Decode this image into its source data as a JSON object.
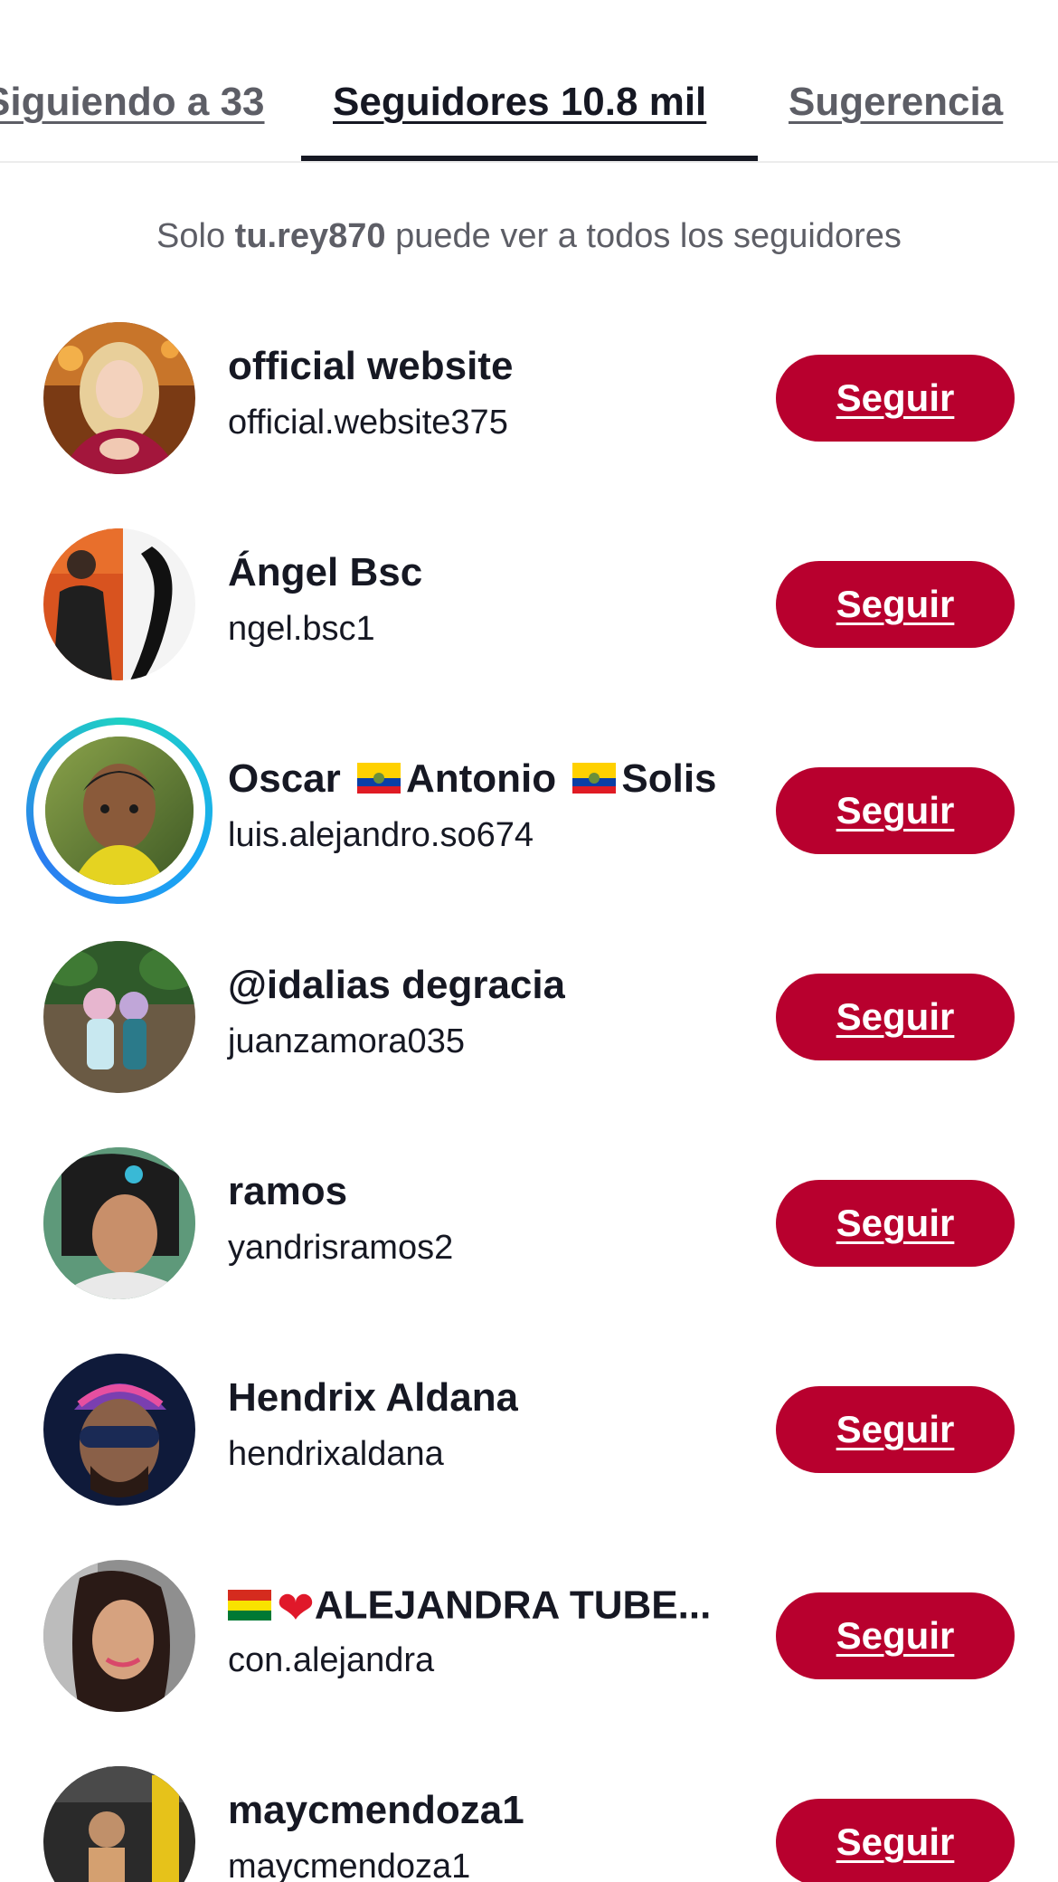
{
  "tabs": {
    "following": "Siguiendo a 33",
    "followers": "Seguidores 10.8 mil",
    "suggestions": "Sugerencia"
  },
  "notice": {
    "prefix": "Solo ",
    "username": "tu.rey870",
    "suffix": " puede ver a todos los seguidores"
  },
  "follow_label": "Seguir",
  "followers": [
    {
      "name": "official website",
      "handle": "official.website375"
    },
    {
      "name": "Ángel Bsc",
      "handle": "ngel.bsc1"
    },
    {
      "name_parts": [
        "Oscar ",
        "Antonio ",
        "Solis"
      ],
      "handle": "luis.alejandro.so674",
      "flag": "ecuador-flag",
      "has_story": true
    },
    {
      "name": "@idalias degracia",
      "handle": "juanzamora035"
    },
    {
      "name": "ramos",
      "handle": "yandrisramos2"
    },
    {
      "name": "Hendrix Aldana",
      "handle": "hendrixaldana"
    },
    {
      "name": "ALEJANDRA TUBE...",
      "handle": "con.alejandra",
      "prefix_icons": [
        "bolivia-flag",
        "heart-icon"
      ]
    },
    {
      "name": "maycmendoza1",
      "handle": "maycmendoza1"
    }
  ],
  "colors": {
    "follow_button": "#b8002e",
    "story_ring_start": "#1fd0c4",
    "story_ring_end": "#2b7df0"
  }
}
